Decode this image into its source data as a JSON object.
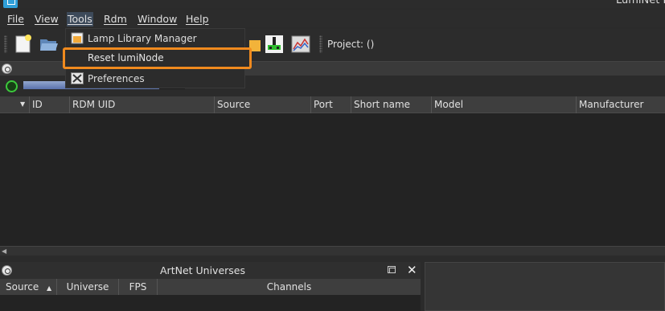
{
  "window": {
    "title": "LumiNet M"
  },
  "menubar": {
    "items": [
      "File",
      "View",
      "Tools",
      "Rdm",
      "Window",
      "Help"
    ]
  },
  "toolbar": {
    "project_label": "Project: ()"
  },
  "tools_menu": {
    "items": [
      {
        "label": "Lamp Library Manager",
        "icon": "folder-icon"
      },
      {
        "label": "Reset lumiNode",
        "icon": ""
      },
      {
        "label": "Preferences",
        "icon": "wrench-screwdriver-icon"
      }
    ]
  },
  "status": {
    "progress_fraction": 0.84,
    "indicator_color": "#3cc93c"
  },
  "device_table": {
    "columns": [
      "ID",
      "RDM UID",
      "Source",
      "Port",
      "Short name",
      "Model",
      "Manufacturer"
    ],
    "rows": []
  },
  "universes_panel": {
    "title": "ArtNet Universes",
    "columns": [
      "Source",
      "Universe",
      "FPS",
      "Channels"
    ],
    "rows": []
  },
  "colors": {
    "highlight": "#f08a1e",
    "accent": "#2f9fd8",
    "menu_active": "#3d4a5a"
  }
}
